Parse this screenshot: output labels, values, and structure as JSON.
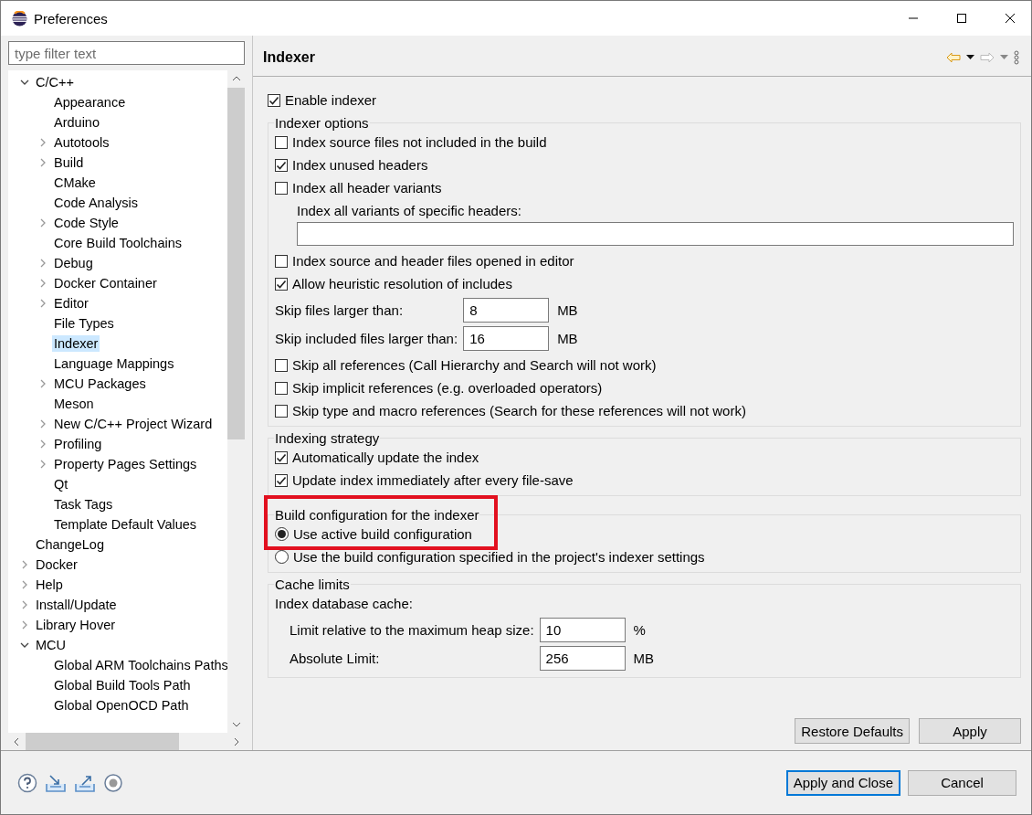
{
  "window": {
    "title": "Preferences"
  },
  "sidebar": {
    "filter": {
      "placeholder": "type filter text"
    },
    "tree": [
      {
        "label": "C/C++",
        "expanded": true,
        "selected": false,
        "children": [
          {
            "label": "Appearance",
            "selected": false
          },
          {
            "label": "Arduino",
            "selected": false
          },
          {
            "label": "Autotools",
            "expanded": false,
            "selected": false
          },
          {
            "label": "Build",
            "expanded": false,
            "selected": false
          },
          {
            "label": "CMake",
            "selected": false
          },
          {
            "label": "Code Analysis",
            "selected": false
          },
          {
            "label": "Code Style",
            "expanded": false,
            "selected": false
          },
          {
            "label": "Core Build Toolchains",
            "selected": false
          },
          {
            "label": "Debug",
            "expanded": false,
            "selected": false
          },
          {
            "label": "Docker Container",
            "expanded": false,
            "selected": false
          },
          {
            "label": "Editor",
            "expanded": false,
            "selected": false
          },
          {
            "label": "File Types",
            "selected": false
          },
          {
            "label": "Indexer",
            "selected": true
          },
          {
            "label": "Language Mappings",
            "selected": false
          },
          {
            "label": "MCU Packages",
            "expanded": false,
            "selected": false
          },
          {
            "label": "Meson",
            "selected": false
          },
          {
            "label": "New C/C++ Project Wizard",
            "expanded": false,
            "selected": false
          },
          {
            "label": "Profiling",
            "expanded": false,
            "selected": false
          },
          {
            "label": "Property Pages Settings",
            "expanded": false,
            "selected": false
          },
          {
            "label": "Qt",
            "selected": false
          },
          {
            "label": "Task Tags",
            "selected": false
          },
          {
            "label": "Template Default Values",
            "selected": false
          }
        ]
      },
      {
        "label": "ChangeLog",
        "selected": false
      },
      {
        "label": "Docker",
        "expanded": false,
        "selected": false
      },
      {
        "label": "Help",
        "expanded": false,
        "selected": false
      },
      {
        "label": "Install/Update",
        "expanded": false,
        "selected": false
      },
      {
        "label": "Library Hover",
        "expanded": false,
        "selected": false
      },
      {
        "label": "MCU",
        "expanded": true,
        "selected": false,
        "children": [
          {
            "label": "Global ARM Toolchains Paths",
            "selected": false
          },
          {
            "label": "Global Build Tools Path",
            "selected": false
          },
          {
            "label": "Global OpenOCD Path",
            "selected": false
          }
        ]
      }
    ]
  },
  "page": {
    "title": "Indexer",
    "enable_indexer": {
      "label": "Enable indexer",
      "checked": true
    },
    "groups": [
      {
        "title": "Indexer options",
        "items": [
          {
            "kind": "checkbox",
            "label": "Index source files not included in the build",
            "checked": false
          },
          {
            "kind": "checkbox",
            "label": "Index unused headers",
            "checked": true
          },
          {
            "kind": "checkbox",
            "label": "Index all header variants",
            "checked": false
          },
          {
            "kind": "text_field",
            "label": "Index all variants of specific headers:"
          },
          {
            "kind": "checkbox",
            "label": "Index source and header files opened in editor",
            "checked": false
          },
          {
            "kind": "checkbox",
            "label": "Allow heuristic resolution of includes",
            "checked": true
          },
          {
            "kind": "number",
            "label": "Skip files larger than:",
            "value": "8",
            "unit": "MB"
          },
          {
            "kind": "number",
            "label": "Skip included files larger than:",
            "value": "16",
            "unit": "MB"
          },
          {
            "kind": "checkbox",
            "label": "Skip all references (Call Hierarchy and Search will not work)",
            "checked": false
          },
          {
            "kind": "checkbox",
            "label": "Skip implicit references (e.g. overloaded operators)",
            "checked": false
          },
          {
            "kind": "checkbox",
            "label": "Skip type and macro references (Search for these references will not work)",
            "checked": false
          }
        ]
      },
      {
        "title": "Indexing strategy",
        "items": [
          {
            "kind": "checkbox",
            "label": "Automatically update the index",
            "checked": true
          },
          {
            "kind": "checkbox",
            "label": "Update index immediately after every file-save",
            "checked": true
          }
        ]
      },
      {
        "title": "Build configuration for the indexer",
        "highlighted": true,
        "items": [
          {
            "kind": "radio",
            "label": "Use active build configuration",
            "selected": true,
            "highlighted": true
          },
          {
            "kind": "radio",
            "label": "Use the build configuration specified in the project's indexer settings",
            "selected": false,
            "highlighted": false
          }
        ]
      },
      {
        "title": "Cache limits",
        "items": [
          {
            "kind": "caption",
            "label": "Index database cache:"
          },
          {
            "kind": "sub_number",
            "label": "Limit relative to the maximum heap size:",
            "value": "10",
            "unit": "%"
          },
          {
            "kind": "sub_number",
            "label": "Absolute Limit:",
            "value": "256",
            "unit": "MB"
          }
        ]
      }
    ],
    "buttons": [
      "Restore Defaults",
      "Apply"
    ]
  },
  "dialog_buttons": [
    {
      "label": "Apply and Close",
      "default": true
    },
    {
      "label": "Cancel",
      "default": false
    }
  ]
}
